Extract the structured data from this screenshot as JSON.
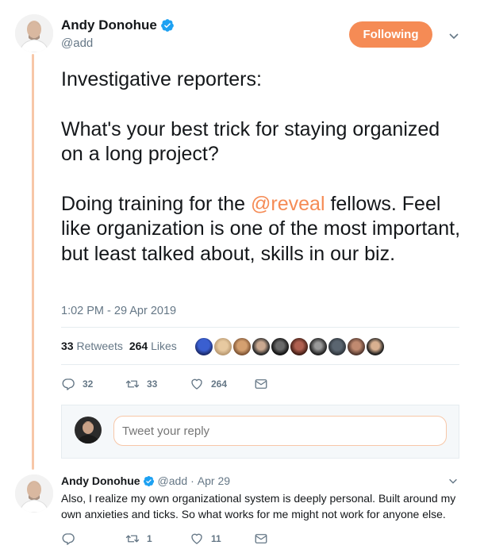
{
  "tweet": {
    "author_name": "Andy Donohue",
    "author_handle": "@add",
    "follow_label": "Following",
    "text_line1": "Investigative reporters:",
    "text_line2": "What's your best trick for staying organized on a long project?",
    "text_line3_pre": "Doing training for the ",
    "text_line3_mention": "@reveal",
    "text_line3_post": " fellows. Feel like organization is one of the most important, but least talked about, skills in our biz.",
    "timestamp": "1:02 PM - 29 Apr 2019",
    "retweets_count": "33",
    "retweets_label": "Retweets",
    "likes_count": "264",
    "likes_label": "Likes",
    "actions": {
      "reply_count": "32",
      "retweet_count": "33",
      "like_count": "264"
    }
  },
  "reply_box": {
    "placeholder": "Tweet your reply"
  },
  "reply_tweet": {
    "author_name": "Andy Donohue",
    "author_handle": "@add",
    "separator": "·",
    "date": "Apr 29",
    "text": "Also, I realize my own organizational system is deeply personal. Built around my own anxieties and ticks. So what works for me might not work for anyone else.",
    "actions": {
      "reply_count": "",
      "retweet_count": "1",
      "like_count": "11"
    }
  },
  "colors": {
    "accent": "#f58b55",
    "thread_line": "#f7c7a8",
    "verified": "#1da1f2",
    "secondary_text": "#657786"
  },
  "icons": [
    "verified-badge-icon",
    "chevron-down-icon",
    "reply-icon",
    "retweet-icon",
    "heart-icon",
    "envelope-icon"
  ]
}
